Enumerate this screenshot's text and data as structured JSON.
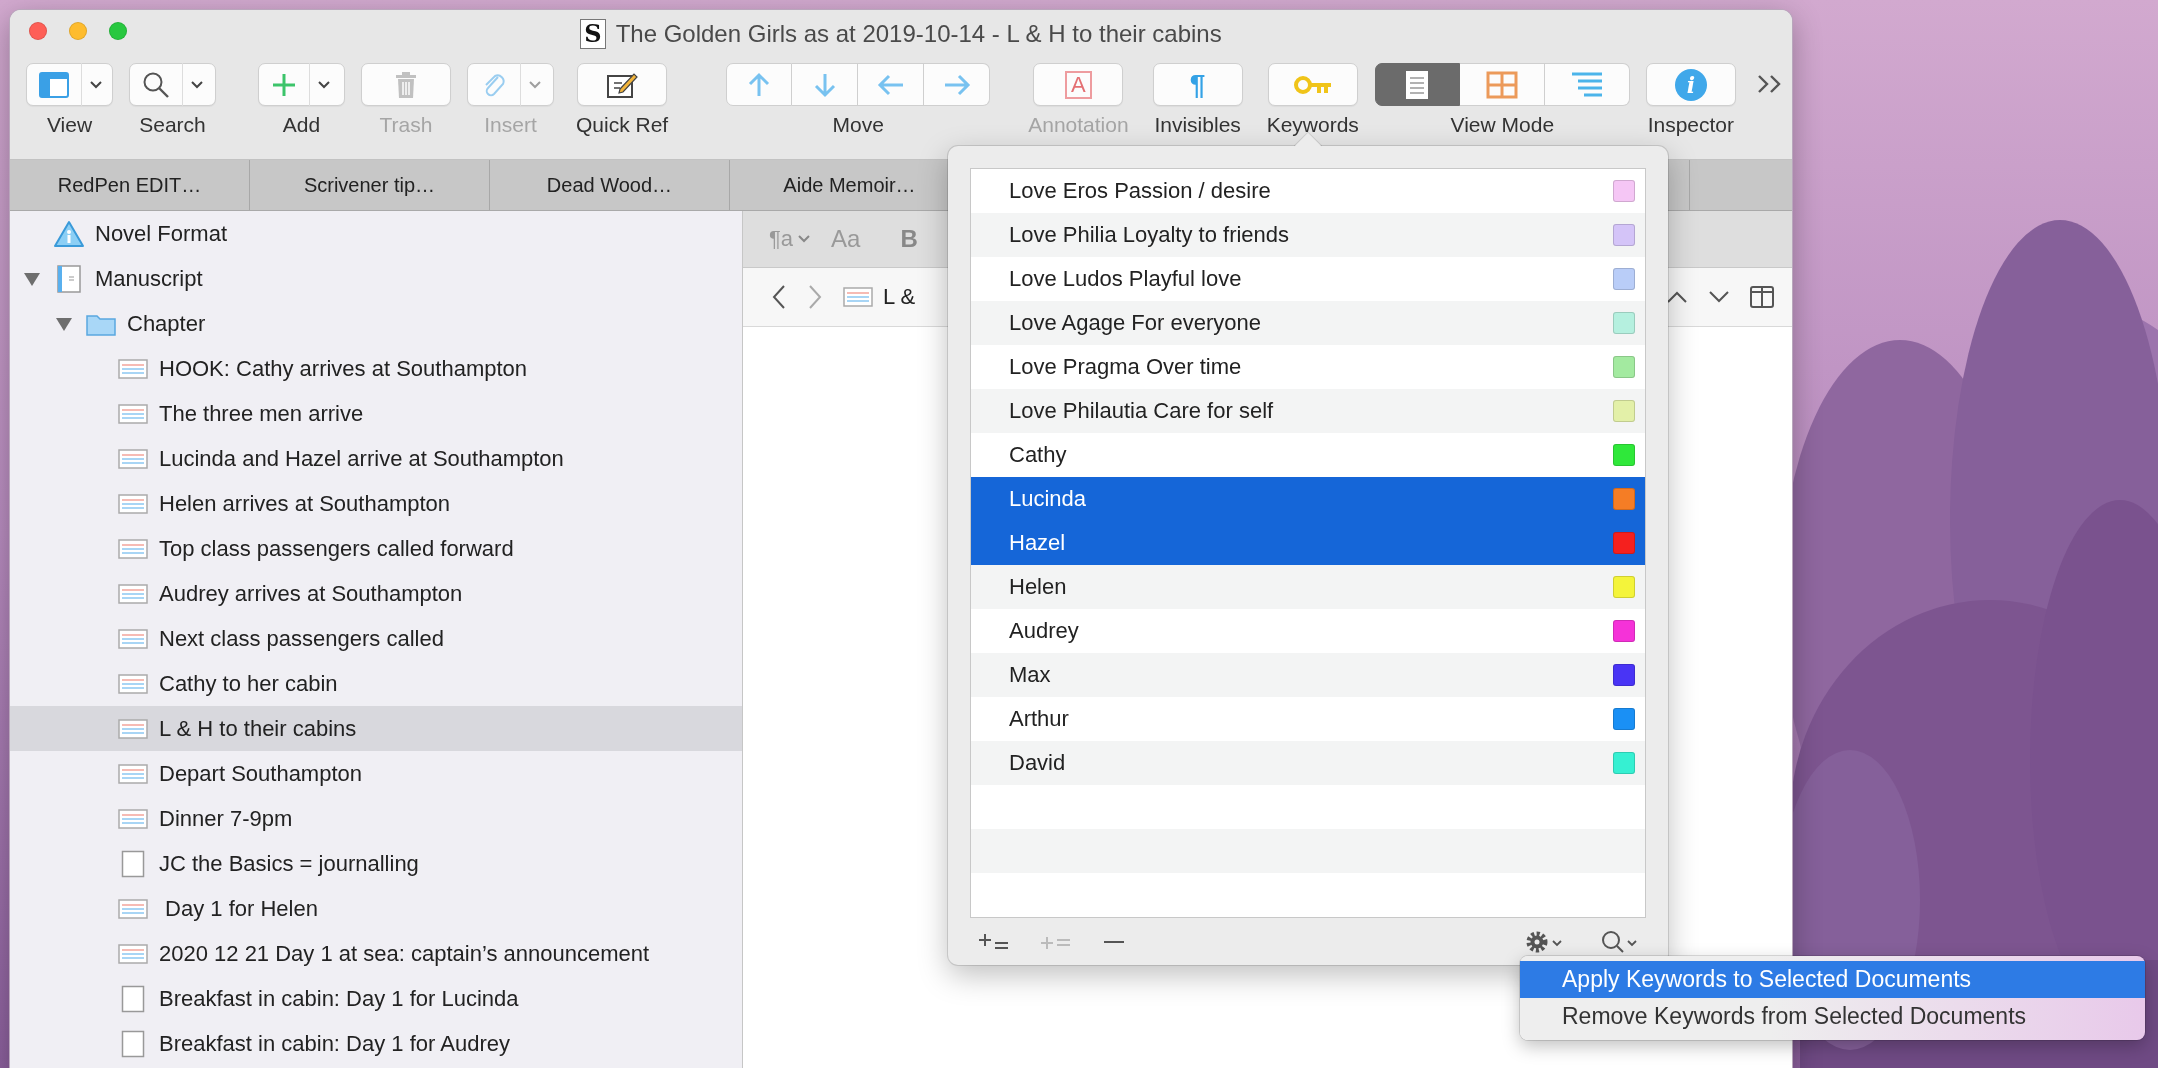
{
  "window": {
    "title": "The Golden Girls as at 2019-10-14 - L & H to their cabins",
    "title_icon_glyph": "S"
  },
  "toolbar": {
    "items": [
      {
        "kind": "combo",
        "label": "View",
        "disabled": false
      },
      {
        "kind": "combo",
        "label": "Search",
        "disabled": false
      },
      {
        "kind": "combo",
        "label": "Add",
        "disabled": false
      },
      {
        "kind": "button",
        "label": "Trash",
        "disabled": true
      },
      {
        "kind": "combo",
        "label": "Insert",
        "disabled": true
      },
      {
        "kind": "button",
        "label": "Quick Ref",
        "disabled": false
      },
      {
        "kind": "group",
        "label": "Move",
        "segments": [
          {
            "disabled": false
          },
          {
            "disabled": false
          },
          {
            "disabled": false
          },
          {
            "disabled": false
          }
        ]
      },
      {
        "kind": "button",
        "label": "Annotation",
        "glyph": "A",
        "disabled": true
      },
      {
        "kind": "button",
        "label": "Invisibles",
        "glyph": "¶",
        "disabled": false
      },
      {
        "kind": "button",
        "label": "Keywords",
        "disabled": false
      },
      {
        "kind": "segmented",
        "label": "View Mode",
        "segments": [
          {
            "selected": true
          },
          {
            "selected": false
          },
          {
            "selected": false
          }
        ]
      },
      {
        "kind": "button",
        "label": "Inspector",
        "glyph": "i",
        "disabled": false
      }
    ]
  },
  "tabs": [
    {
      "label": "RedPen EDIT…"
    },
    {
      "label": "Scrivener tip…"
    },
    {
      "label": "Dead Wood…"
    },
    {
      "label": "Aide Memoir…"
    }
  ],
  "binder": {
    "items": [
      {
        "label": "Novel Format",
        "kind": "info",
        "selected": false
      },
      {
        "label": "Manuscript",
        "kind": "manuscript",
        "selected": false,
        "expanded": true,
        "children": [
          {
            "label": "Chapter",
            "kind": "folder",
            "selected": false,
            "expanded": true,
            "children": [
              {
                "label": "HOOK: Cathy arrives at Southampton",
                "kind": "text",
                "selected": false
              },
              {
                "label": "The three men arrive",
                "kind": "text",
                "selected": false
              },
              {
                "label": "Lucinda and Hazel arrive at Southampton",
                "kind": "text",
                "selected": false
              },
              {
                "label": "Helen arrives at Southampton",
                "kind": "text",
                "selected": false
              },
              {
                "label": "Top class passengers called forward",
                "kind": "text",
                "selected": false
              },
              {
                "label": "Audrey arrives at Southampton",
                "kind": "text",
                "selected": false
              },
              {
                "label": "Next class passengers called",
                "kind": "text",
                "selected": false
              },
              {
                "label": "Cathy to her cabin",
                "kind": "text",
                "selected": false
              },
              {
                "label": "L & H to their cabins",
                "kind": "text",
                "selected": true
              },
              {
                "label": "Depart Southampton",
                "kind": "text",
                "selected": false
              },
              {
                "label": "Dinner 7-9pm",
                "kind": "text",
                "selected": false
              },
              {
                "label": "JC the Basics = journalling",
                "kind": "blank",
                "selected": false
              },
              {
                "label": " Day 1 for Helen",
                "kind": "text",
                "selected": false
              },
              {
                "label": "2020 12 21 Day 1 at sea: captain’s announcement",
                "kind": "text",
                "selected": false
              },
              {
                "label": "Breakfast in cabin: Day 1 for Lucinda",
                "kind": "blank",
                "selected": false
              },
              {
                "label": "Breakfast in cabin: Day 1 for Audrey",
                "kind": "blank",
                "selected": false
              }
            ]
          }
        ]
      }
    ]
  },
  "editor": {
    "format_bar": {
      "paragraph_style": "¶a",
      "font": "Aa",
      "bold": "B"
    },
    "header": {
      "document_title": "L &"
    }
  },
  "keywords": {
    "items": [
      {
        "name": "Love Eros Passion / desire",
        "color": "#f5c6f5",
        "selected": false
      },
      {
        "name": "Love Philia Loyalty to friends",
        "color": "#d4c4f8",
        "selected": false
      },
      {
        "name": "Love Ludos Playful love",
        "color": "#b9cdf8",
        "selected": false
      },
      {
        "name": "Love Agage For everyone",
        "color": "#b5f0df",
        "selected": false
      },
      {
        "name": "Love Pragma Over time",
        "color": "#a3eaa0",
        "selected": false
      },
      {
        "name": "Love Philautia Care for self",
        "color": "#e3f0a8",
        "selected": false
      },
      {
        "name": "Cathy",
        "color": "#2fe83a",
        "selected": false
      },
      {
        "name": "Lucinda",
        "color": "#f57d25",
        "selected": true
      },
      {
        "name": "Hazel",
        "color": "#f5201e",
        "selected": true
      },
      {
        "name": "Helen",
        "color": "#f4f43a",
        "selected": false
      },
      {
        "name": "Audrey",
        "color": "#f532d8",
        "selected": false
      },
      {
        "name": "Max",
        "color": "#4934f5",
        "selected": false
      },
      {
        "name": "Arthur",
        "color": "#1a90f5",
        "selected": false
      },
      {
        "name": "David",
        "color": "#36f0d2",
        "selected": false
      }
    ],
    "tools": [
      {
        "kind": "add",
        "disabled": false
      },
      {
        "kind": "add-child",
        "disabled": true
      },
      {
        "kind": "remove",
        "disabled": false
      },
      {
        "kind": "actions",
        "disabled": false
      },
      {
        "kind": "search",
        "disabled": false
      }
    ]
  },
  "context_menu": {
    "items": [
      {
        "label": "Apply Keywords to Selected Documents",
        "selected": true
      },
      {
        "label": "Remove Keywords from Selected Documents",
        "selected": false
      }
    ]
  }
}
